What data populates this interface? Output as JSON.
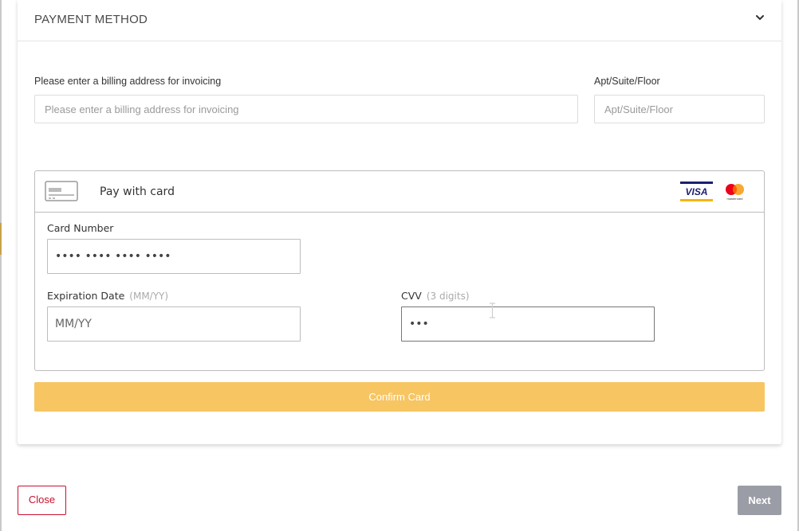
{
  "section": {
    "title": "PAYMENT METHOD",
    "collapse_icon": "chevron-down-icon"
  },
  "billing": {
    "address_label": "Please enter a billing address for invoicing",
    "address_placeholder": "Please enter a billing address for invoicing",
    "address_value": "",
    "apt_label": "Apt/Suite/Floor",
    "apt_placeholder": "Apt/Suite/Floor",
    "apt_value": ""
  },
  "card": {
    "header_icon": "credit-card-icon",
    "title": "Pay with card",
    "brands": [
      "VISA",
      "mastercard"
    ],
    "number_label": "Card Number",
    "number_value": "•••• •••• •••• ••••",
    "expiry_label": "Expiration Date",
    "expiry_hint": "(MM/YY)",
    "expiry_placeholder": "MM/YY",
    "cvv_label": "CVV",
    "cvv_hint": "(3 digits)",
    "cvv_value": "•••",
    "confirm_label": "Confirm Card"
  },
  "footer": {
    "close_label": "Close",
    "next_label": "Next"
  },
  "colors": {
    "confirm_button": "#f7c562",
    "close_button_border": "#c8102e",
    "next_button": "#9b9da6",
    "visa_blue": "#1a1f71",
    "visa_gold": "#f7b600",
    "mastercard_red": "#eb001b",
    "mastercard_orange": "#f79e1b"
  }
}
